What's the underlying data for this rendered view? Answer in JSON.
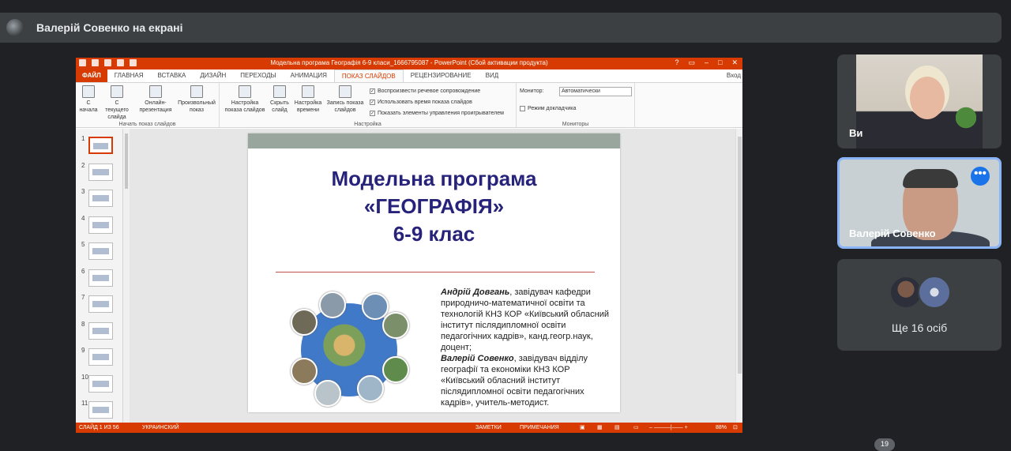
{
  "presenter_bar": {
    "title": "Валерій Совенко на екрані"
  },
  "ppt": {
    "window_title": "Модельна програма Географія 6-9 класи_1666795087 - PowerPoint (Сбой активации продукта)",
    "tabs": [
      "ФАЙЛ",
      "ГЛАВНАЯ",
      "ВСТАВКА",
      "ДИЗАЙН",
      "ПЕРЕХОДЫ",
      "АНИМАЦИЯ",
      "ПОКАЗ СЛАЙДОВ",
      "РЕЦЕНЗИРОВАНИЕ",
      "ВИД"
    ],
    "active_tab": "ПОКАЗ СЛАЙДОВ",
    "login": "Вход",
    "ribbon": {
      "group_start": {
        "label": "Начать показ слайдов",
        "buttons": [
          "С начала",
          "С текущего слайда",
          "Онлайн-презентация",
          "Произвольный показ"
        ]
      },
      "group_setup": {
        "label": "Настройка",
        "buttons": [
          "Настройка показа слайдов",
          "Скрыть слайд",
          "Настройка времени",
          "Запись показа слайдов"
        ],
        "checks": [
          "Воспроизвести речевое сопровождение",
          "Использовать время показа слайдов",
          "Показать элементы управления проигрывателем"
        ]
      },
      "group_monitors": {
        "label": "Мониторы",
        "monitor_label": "Монитор:",
        "monitor_value": "Автоматически",
        "presenter_view": "Режим докладчика"
      }
    },
    "slide_numbers": [
      "1",
      "2",
      "3",
      "4",
      "5",
      "6",
      "7",
      "8",
      "9",
      "10",
      "11"
    ],
    "slide": {
      "title_line1": "Модельна програма",
      "title_line2": "«ГЕОГРАФІЯ»",
      "title_line3": "6-9 клас",
      "author1_name": "Андрій Довгань",
      "author1_text": ", завідувач кафедри природничо-математичної освіти та технологій КНЗ КОР «Київський обласний інститут післядипломної освіти педагогічних кадрів», канд.геогр.наук, доцент;",
      "author2_name": "Валерій Совенко",
      "author2_text": ", завідувач відділу географії та економіки КНЗ КОР «Київський обласний інститут післядипломної освіти педагогічних кадрів», учитель-методист."
    },
    "status": {
      "slide_of": "СЛАЙД 1 ИЗ 56",
      "language": "УКРАИНСКИЙ",
      "notes": "ЗАМЕТКИ",
      "comments": "ПРИМЕЧАНИЯ",
      "zoom": "88%"
    }
  },
  "participants": {
    "self_label": "Ви",
    "speaker_name": "Валерій Совенко",
    "more_label": "Ще 16 осіб",
    "badge": "19"
  }
}
